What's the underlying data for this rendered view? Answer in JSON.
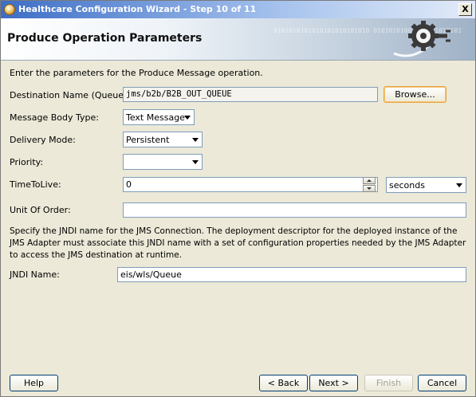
{
  "window": {
    "title": "Healthcare Configuration Wizard - Step 10 of 11",
    "close_glyph": "X"
  },
  "header": {
    "title": "Produce Operation Parameters",
    "decoration_text": "0101010101010101010101010\n01010101001010101010101",
    "graphic_icon": "gear-plug-icon"
  },
  "intro": "Enter the parameters for the Produce Message operation.",
  "fields": {
    "destination": {
      "label": "Destination Name (Queue):",
      "value": "jms/b2b/B2B_OUT_QUEUE",
      "browse_label": "Browse..."
    },
    "message_body_type": {
      "label": "Message Body Type:",
      "value": "Text Message"
    },
    "delivery_mode": {
      "label": "Delivery Mode:",
      "value": "Persistent"
    },
    "priority": {
      "label": "Priority:",
      "value": ""
    },
    "time_to_live": {
      "label": "TimeToLive:",
      "value": "0",
      "unit": "seconds"
    },
    "unit_of_order": {
      "label": "Unit Of Order:",
      "value": ""
    },
    "jndi_name": {
      "label": "JNDI Name:",
      "value": "eis/wls/Queue"
    }
  },
  "jndi_description": "Specify the JNDI name for the JMS Connection.  The deployment descriptor for the deployed instance of the JMS Adapter must associate this JNDI name with a set of configuration properties needed by the JMS Adapter to access the JMS destination at runtime.",
  "buttons": {
    "help": "Help",
    "back": "< Back",
    "next": "Next >",
    "finish": "Finish",
    "cancel": "Cancel"
  },
  "colors": {
    "titlebar_start": "#3d6ec6",
    "dialog_background": "#ece9d8",
    "field_border": "#7f9db9",
    "focus_highlight": "#e9a33c"
  }
}
